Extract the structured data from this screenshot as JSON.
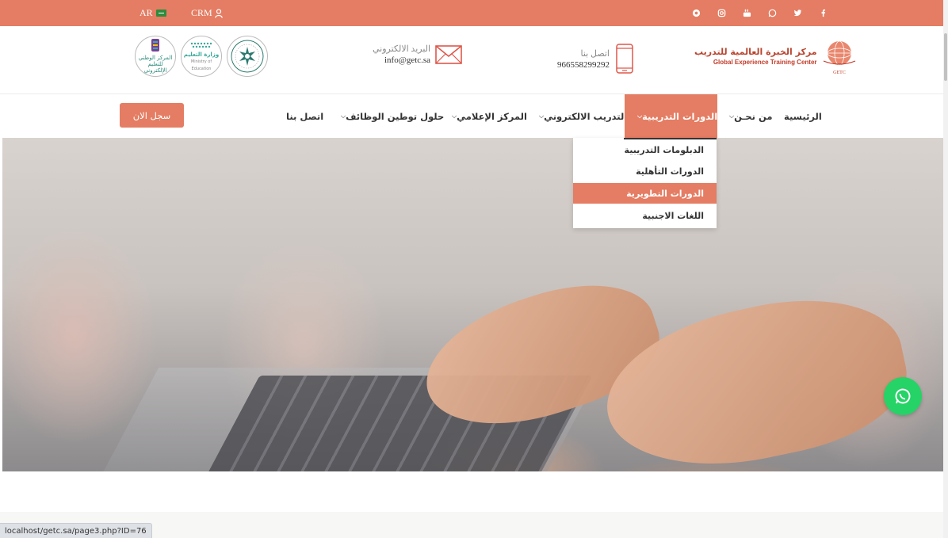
{
  "topbar": {
    "lang_label": "AR",
    "crm_label": "CRM",
    "bg_color": "#e47d63",
    "socials": [
      {
        "name": "instagram-alt-icon"
      },
      {
        "name": "instagram-icon"
      },
      {
        "name": "youtube-icon"
      },
      {
        "name": "whatsapp-icon"
      },
      {
        "name": "twitter-icon"
      },
      {
        "name": "facebook-icon"
      }
    ]
  },
  "header": {
    "email_label": "البريد الالكتروني",
    "email_value": "info@getc.sa",
    "phone_label": "اتصل بنا",
    "phone_value": "966558299292",
    "brand_ar": "مركز الخبرة العالمية للتدريب",
    "brand_en": "Global Experience Training Center",
    "brand_short": "GETC",
    "partners": [
      {
        "line1": "المركز الوطني",
        "line2": "للتعليم الإلكتروني"
      },
      {
        "line1": "وزارة التعليم",
        "line2": "Ministry of Education"
      },
      {
        "line1": "",
        "line2": ""
      }
    ]
  },
  "nav": {
    "register_label": "سجل الان",
    "items": [
      {
        "label": "الرئيسية",
        "has_dropdown": false
      },
      {
        "label": "من نحـن",
        "has_dropdown": true
      },
      {
        "label": "الدورات التدريبية",
        "has_dropdown": true,
        "active": true
      },
      {
        "label": "التدريب الالكتروني",
        "has_dropdown": true
      },
      {
        "label": "المركز الإعلامي",
        "has_dropdown": true
      },
      {
        "label": "حلول توطين الوظائف",
        "has_dropdown": true
      },
      {
        "label": "اتصل بنا",
        "has_dropdown": false
      }
    ]
  },
  "dropdown": {
    "items": [
      {
        "label": "الدبلومات التدريبية"
      },
      {
        "label": "الدورات التأهلية"
      },
      {
        "label": "الدورات التطويرية",
        "active": true
      },
      {
        "label": "اللغات الاجنبية"
      }
    ]
  },
  "statusbar": {
    "url": "localhost/getc.sa/page3.php?ID=76"
  },
  "colors": {
    "accent": "#e47d63",
    "whatsapp": "#25d366"
  }
}
